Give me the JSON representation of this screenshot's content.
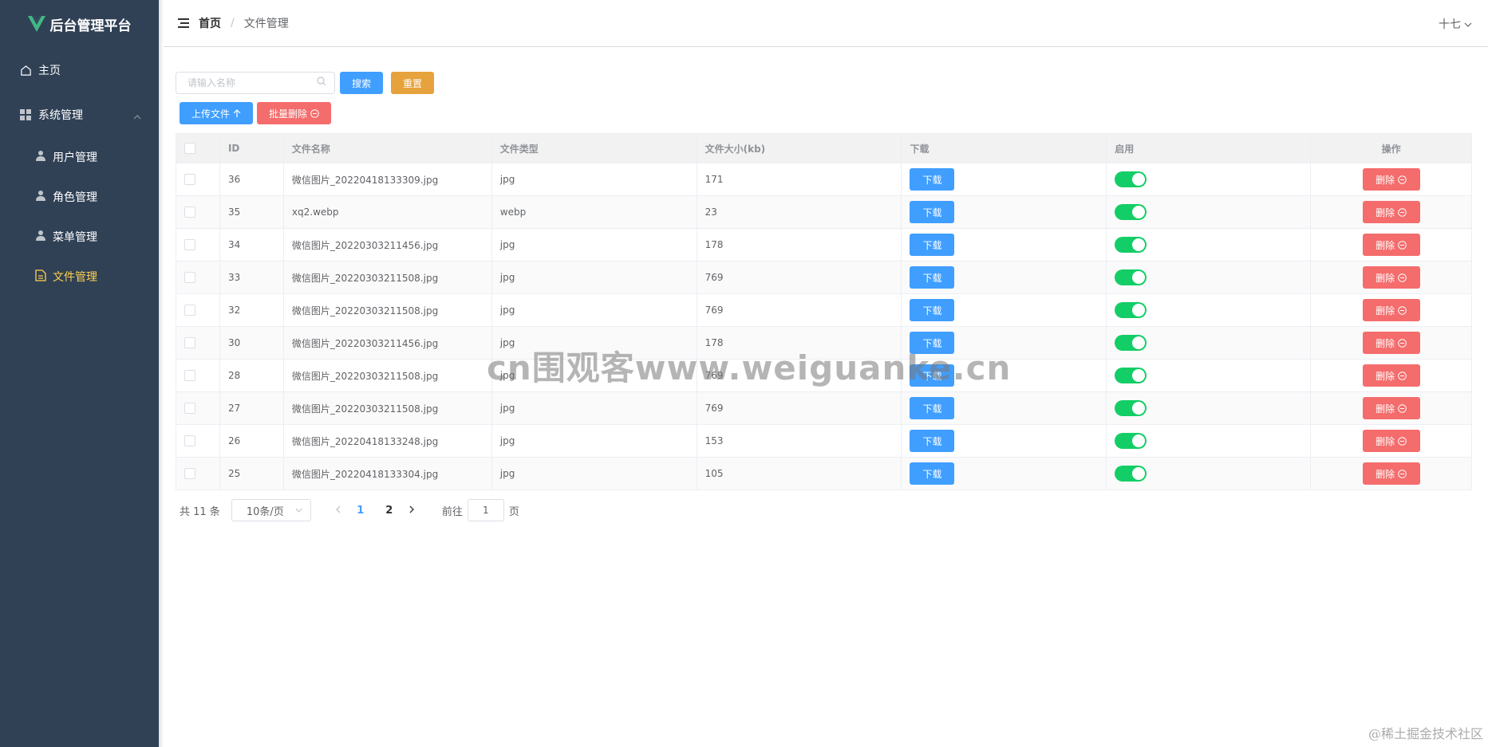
{
  "app": {
    "title": "后台管理平台"
  },
  "menu": {
    "home": "主页",
    "system": "系统管理",
    "subs": [
      {
        "label": "用户管理",
        "active": false
      },
      {
        "label": "角色管理",
        "active": false
      },
      {
        "label": "菜单管理",
        "active": false
      },
      {
        "label": "文件管理",
        "active": true
      }
    ]
  },
  "header": {
    "breadcrumb_home": "首页",
    "breadcrumb_sep": "/",
    "breadcrumb_current": "文件管理",
    "user": "十七"
  },
  "search": {
    "placeholder": "请输入名称",
    "value": ""
  },
  "buttons": {
    "search": "搜索",
    "reset": "重置",
    "upload": "上传文件",
    "batch_delete": "批量删除",
    "download": "下载",
    "delete": "删除"
  },
  "table": {
    "headers": [
      "ID",
      "文件名称",
      "文件类型",
      "文件大小(kb)",
      "下载",
      "启用",
      "操作"
    ],
    "rows": [
      {
        "id": "36",
        "name": "微信图片_20220418133309.jpg",
        "type": "jpg",
        "size": "171",
        "enabled": true
      },
      {
        "id": "35",
        "name": "xq2.webp",
        "type": "webp",
        "size": "23",
        "enabled": true
      },
      {
        "id": "34",
        "name": "微信图片_20220303211456.jpg",
        "type": "jpg",
        "size": "178",
        "enabled": true
      },
      {
        "id": "33",
        "name": "微信图片_20220303211508.jpg",
        "type": "jpg",
        "size": "769",
        "enabled": true
      },
      {
        "id": "32",
        "name": "微信图片_20220303211508.jpg",
        "type": "jpg",
        "size": "769",
        "enabled": true
      },
      {
        "id": "30",
        "name": "微信图片_20220303211456.jpg",
        "type": "jpg",
        "size": "178",
        "enabled": true
      },
      {
        "id": "28",
        "name": "微信图片_20220303211508.jpg",
        "type": "jpg",
        "size": "769",
        "enabled": true
      },
      {
        "id": "27",
        "name": "微信图片_20220303211508.jpg",
        "type": "jpg",
        "size": "769",
        "enabled": true
      },
      {
        "id": "26",
        "name": "微信图片_20220418133248.jpg",
        "type": "jpg",
        "size": "153",
        "enabled": true
      },
      {
        "id": "25",
        "name": "微信图片_20220418133304.jpg",
        "type": "jpg",
        "size": "105",
        "enabled": true
      }
    ]
  },
  "pagination": {
    "total_text": "共 11 条",
    "page_size": "10条/页",
    "pages": [
      "1",
      "2"
    ],
    "current_page": "1",
    "goto_label": "前往",
    "goto_value": "1",
    "page_suffix": "页"
  },
  "watermarks": {
    "center": "cn围观客www.weiguanke.cn",
    "corner": "@稀土掘金技术社区"
  },
  "colors": {
    "sidebar_bg": "#304156",
    "active_menu": "#ffd04b",
    "primary": "#409eff",
    "warning": "#e6a23c",
    "danger": "#f56c6c",
    "switch_on": "#13ce66"
  }
}
